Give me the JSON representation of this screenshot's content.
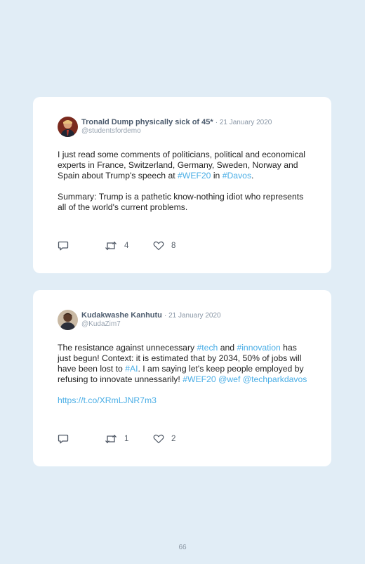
{
  "tweets": [
    {
      "author": "Tronald Dump physically sick of 45*",
      "date": "· 21 January 2020",
      "handle": "@studentsfordemo",
      "paragraph1": [
        {
          "text": "I just read some comments of politicians, political and economical experts in France, Switzerland, Germany, Sweden, Norway and Spain about Trump's speech at "
        },
        {
          "text": "#WEF20",
          "link": true
        },
        {
          "text": " in "
        },
        {
          "text": "#Davos",
          "link": true
        },
        {
          "text": "."
        }
      ],
      "paragraph2": [
        {
          "text": "Summary: Trump is a pathetic know-nothing idiot who represents all of the world's current problems."
        }
      ],
      "retweets": "4",
      "likes": "8"
    },
    {
      "author": "Kudakwashe Kanhutu",
      "date": "· 21 January 2020",
      "handle": "@KudaZim7",
      "paragraph1": [
        {
          "text": "The resistance against unnecessary "
        },
        {
          "text": "#tech",
          "link": true
        },
        {
          "text": " and "
        },
        {
          "text": "#innovation",
          "link": true
        },
        {
          "text": " has just begun! Context: it is estimated that by 2034, 50% of jobs will have been lost to "
        },
        {
          "text": "#AI",
          "link": true
        },
        {
          "text": ". I am saying let's keep people employed by refusing to innovate unnessarily! "
        },
        {
          "text": "#WEF20",
          "link": true
        },
        {
          "text": " "
        },
        {
          "text": "@wef",
          "link": true
        },
        {
          "text": " "
        },
        {
          "text": "@techparkdavos",
          "link": true
        }
      ],
      "paragraph2": [
        {
          "text": "https://t.co/XRmLJNR7m3",
          "link": true
        }
      ],
      "retweets": "1",
      "likes": "2"
    }
  ],
  "page_number": "66",
  "colors": {
    "background": "#e1edf6",
    "link": "#4aaee6",
    "card": "#ffffff"
  },
  "icons": [
    "reply-icon",
    "retweet-icon",
    "heart-icon"
  ]
}
